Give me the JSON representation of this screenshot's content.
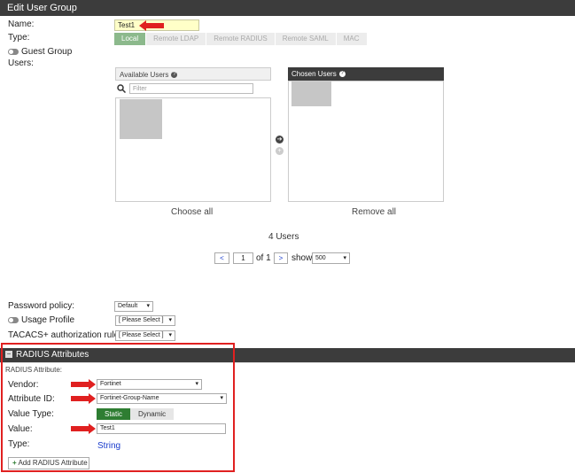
{
  "window": {
    "title": "Edit User Group"
  },
  "form": {
    "name_label": "Name:",
    "name_value": "Test1",
    "type_label": "Type:",
    "type_options": [
      "Local",
      "Remote LDAP",
      "Remote RADIUS",
      "Remote SAML",
      "MAC"
    ],
    "guest_group_label": "Guest Group",
    "users_label": "Users:"
  },
  "users": {
    "available_header": "Available Users",
    "chosen_header": "Chosen Users",
    "filter_placeholder": "Filter",
    "choose_all": "Choose all",
    "remove_all": "Remove all",
    "count_text": "4 Users",
    "pagination": {
      "prev": "<",
      "page": "1",
      "of_text": "of 1",
      "next": ">",
      "show_label": "show",
      "page_size": "500"
    }
  },
  "policies": {
    "password_policy_label": "Password policy:",
    "password_policy_value": "Default",
    "usage_profile_label": "Usage Profile",
    "usage_profile_value": "[ Please Select ]",
    "tacacs_label": "TACACS+ authorization rule:",
    "tacacs_value": "[ Please Select ]"
  },
  "radius": {
    "section_title": "RADIUS Attributes",
    "attr_heading": "RADIUS Attribute:",
    "vendor_label": "Vendor:",
    "vendor_value": "Fortinet",
    "attribute_id_label": "Attribute ID:",
    "attribute_id_value": "Fortinet-Group-Name",
    "value_type_label": "Value Type:",
    "value_type_static": "Static",
    "value_type_dynamic": "Dynamic",
    "value_label": "Value:",
    "value_value": "Test1",
    "type_label": "Type:",
    "type_value": "String",
    "add_button": "Add RADIUS Attribute"
  },
  "colors": {
    "title_bar": "#3c3c3c",
    "active_tab": "#8cb98c",
    "static_toggle": "#2e7d32",
    "annotation_red": "#e02020",
    "type_link_blue": "#1a3ccc"
  }
}
